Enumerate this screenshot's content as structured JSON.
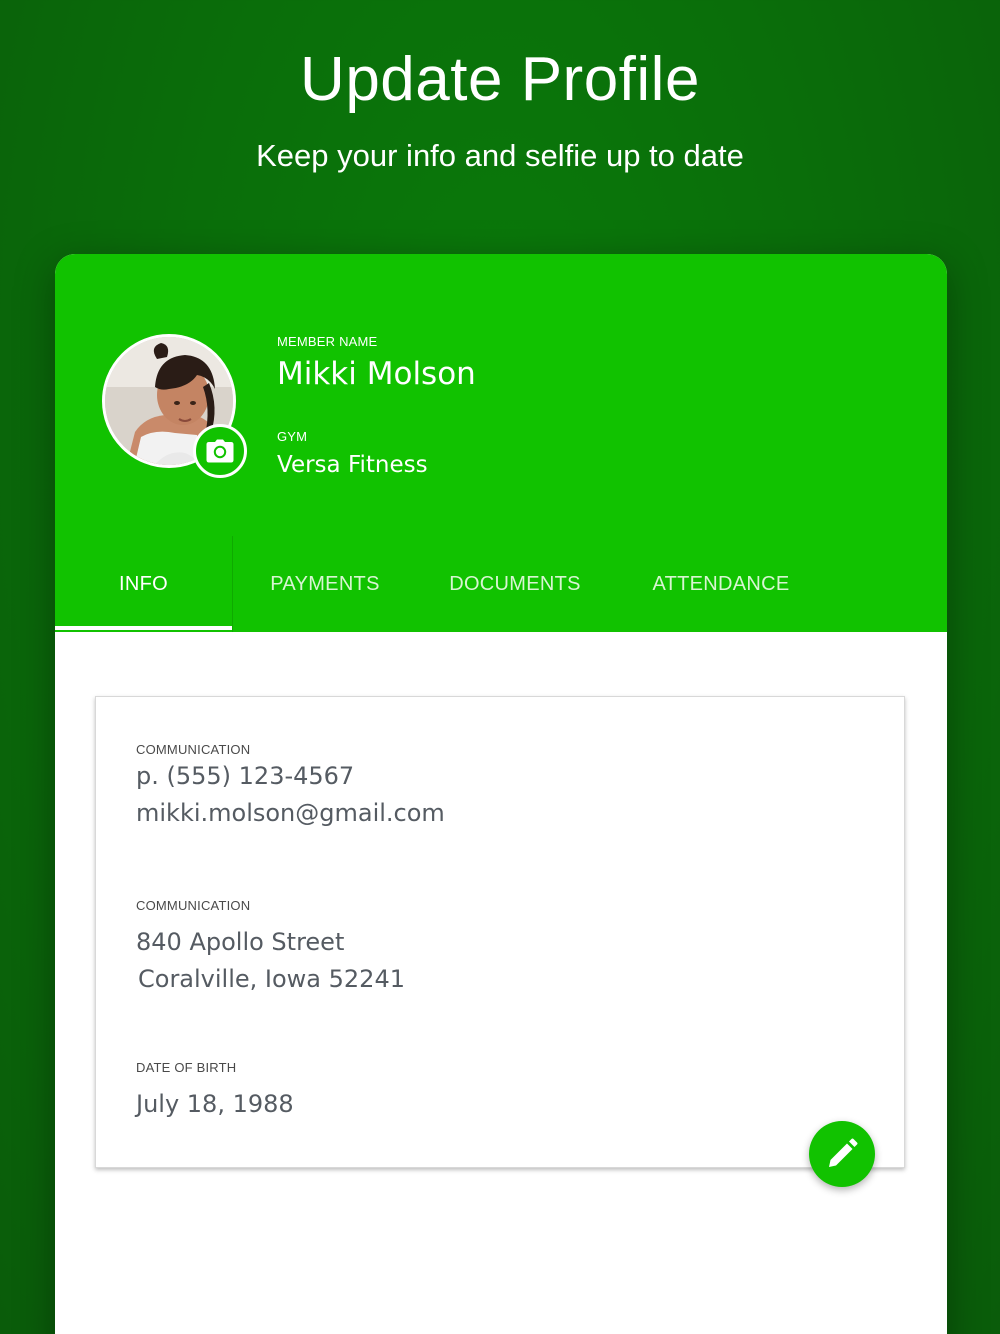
{
  "promo": {
    "title": "Update Profile",
    "subtitle": "Keep your info and selfie up to date"
  },
  "profile": {
    "member_name_label": "MEMBER NAME",
    "member_name": "Mikki Molson",
    "gym_label": "GYM",
    "gym": "Versa Fitness",
    "avatar_icon": "profile-photo",
    "camera_icon": "camera-icon"
  },
  "tabs": [
    {
      "label": "INFO",
      "active": true
    },
    {
      "label": "PAYMENTS",
      "active": false
    },
    {
      "label": "DOCUMENTS",
      "active": false
    },
    {
      "label": "ATTENDANCE",
      "active": false
    }
  ],
  "info": {
    "contact_label": "COMMUNICATION",
    "phone": "p. (555) 123-4567",
    "email": "mikki.molson@gmail.com",
    "address_label": "COMMUNICATION",
    "address_line1": "840 Apollo Street",
    "address_line2": "Coralville, Iowa 52241",
    "dob_label": "DATE OF BIRTH",
    "dob": "July 18, 1988"
  },
  "fab": {
    "icon": "pencil-icon"
  },
  "colors": {
    "background": "#0a6e0a",
    "accent": "#11c200",
    "text_dark": "#555b62"
  }
}
